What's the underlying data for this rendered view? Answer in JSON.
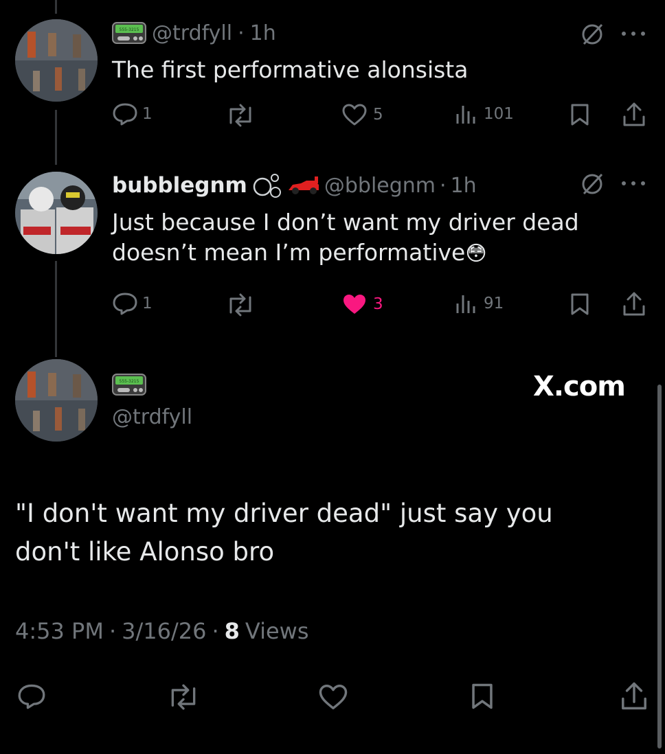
{
  "reply1": {
    "handle": "@trdfyll",
    "sep": "·",
    "time": "1h",
    "text": "The first performative alonsista",
    "replies": "1",
    "likes": "5",
    "views": "101"
  },
  "reply2": {
    "display_name": "bubblegnm",
    "handle": "@bblegnm",
    "sep": "·",
    "time": "1h",
    "text_line1": "Just because I don’t want my driver dead",
    "text_line2": "doesn’t mean I’m performative",
    "emoji": "😳",
    "replies": "1",
    "likes": "3",
    "views": "91",
    "like_color": "#f91880"
  },
  "main": {
    "handle": "@trdfyll",
    "watermark": "X.com",
    "text_line1": "\"I don't want my driver dead\" just say you",
    "text_line2": "don't like Alonso bro",
    "time": "4:53 PM",
    "sep1": "·",
    "date": "3/16/26",
    "sep2": "·",
    "views_count": "8",
    "views_label": "Views"
  },
  "badge": {
    "label": "555-3215"
  },
  "icons": [
    "reply-icon",
    "retweet-icon",
    "like-icon",
    "views-icon",
    "bookmark-icon",
    "share-icon",
    "grok-icon",
    "more-icon",
    "pager-icon",
    "bubbles-icon",
    "race-car-icon"
  ],
  "colors": {
    "background": "#000000",
    "text": "#e7e9ea",
    "muted": "#71767b",
    "like": "#f91880",
    "badge": "#4caf50"
  }
}
